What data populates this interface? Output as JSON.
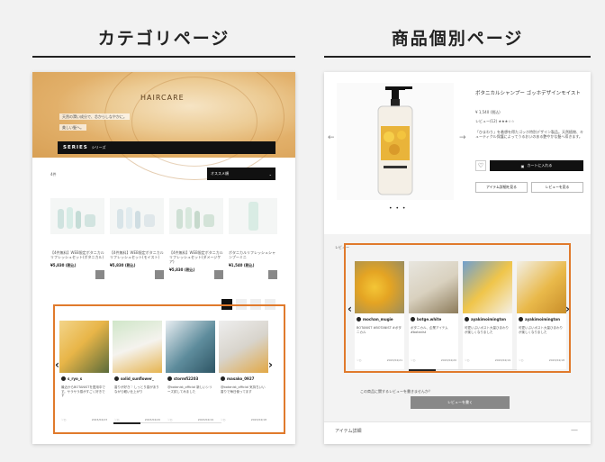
{
  "headers": {
    "category": "カテゴリページ",
    "product": "商品個別ページ"
  },
  "category_page": {
    "hero_title": "HAIRCARE",
    "hero_lines": [
      "天然の潤い成分で、芯からしなやかに。",
      "美しい髪へ。"
    ],
    "series_label": "SERIES",
    "series_sub": "シリーズ",
    "sort_count": "4件",
    "sort_label": "オススメ順",
    "products": [
      {
        "name": "【4件無料】WEB限定ボタニカルリフレッシュセット(ボタニカル)",
        "price": "¥5,830 (税込)"
      },
      {
        "name": "【4件無料】WEB限定ボタニカルリフレッシュセット(モイスト)",
        "price": "¥5,830 (税込)"
      },
      {
        "name": "【4件無料】WEB限定ボタニカルリフレッシュセット(ダメージケア)",
        "price": "¥5,830 (税込)"
      },
      {
        "name": "ボタニカルリフレッシュシャンプーミニ",
        "price": "¥1,540 (税込)"
      }
    ],
    "ugc": [
      {
        "user": "s_ryo_s",
        "caption": "最近からBOTANISTを愛用中です。サラサラ感がすごく好きです",
        "date": "2023/04/23"
      },
      {
        "user": "solid_sunflower_",
        "caption": "香りが好き♡ しっとり感がありながら軽い仕上がり",
        "date": "2023/04/20"
      },
      {
        "user": "stormfi2203",
        "caption": "@botanist_official 新しいシリーズ試してみました",
        "date": "2023/04/19"
      },
      {
        "user": "masako_0927",
        "caption": "@botanist_official 気持ちいい香りで毎日使ってます",
        "date": "2023/04/18"
      }
    ]
  },
  "product_page": {
    "title": "ボタニカルシャンプー ゴッホデザインモイスト",
    "price": "¥ 1,540 (税込)",
    "review": "レビュー(12) ★★★☆☆",
    "desc": "「ひまわり」を着想を得たゴッホ特別デザイン製品。天然植物、キューティクル保護によってうるおいのある艶やかな髪へ導きます。",
    "cart_label": "カートに入れる",
    "detail_btn": "アイテム詳細を見る",
    "review_btn": "レビューを見る",
    "review_heading": "レビュー",
    "ugc": [
      {
        "user": "mochan_mugie",
        "caption": "BOTANIST #BOTANIST #ボタニカル",
        "date": "2023/04/21"
      },
      {
        "user": "botge.white",
        "caption": "ボタニカル、企業アイテム #botanist",
        "date": "2023/04/20"
      },
      {
        "user": "ayakimoimington",
        "caption": "可愛いぷいポスト大量ひまわりが楽しくなりました",
        "date": "2023/04/19"
      },
      {
        "user": "ayakimoimington",
        "caption": "可愛いぷいポスト大量ひまわりが楽しくなりました",
        "date": "2023/04/18"
      }
    ],
    "review_prompt": "この商品に関するレビューを書きませんか？",
    "review_write": "レビューを書く",
    "item_detail": "アイテム詳細"
  }
}
